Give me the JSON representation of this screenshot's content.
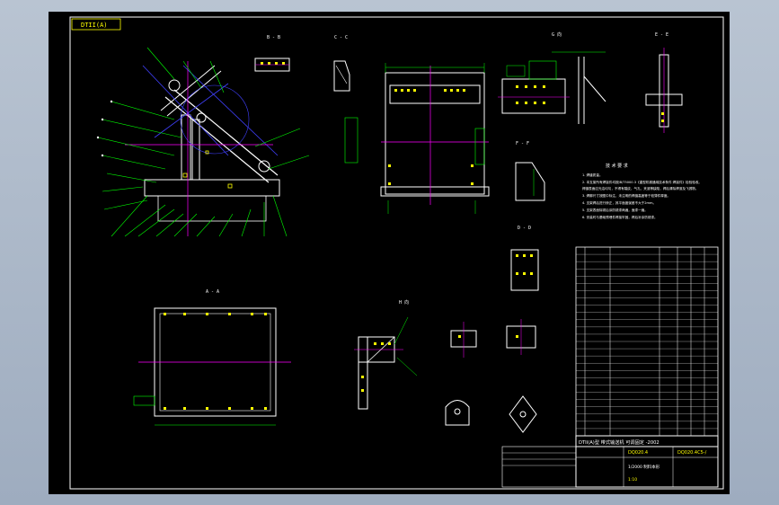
{
  "drawing": {
    "code_label": "DTII(A)",
    "title_block": {
      "main_title": "DTII(A)型 带式输送机 可调固定 -2002",
      "drawing_no": "DQ020.4",
      "sheet_code": "DQ020.4C5-/",
      "part_name": "1/2000 制料本形",
      "scale": "1:10"
    },
    "tech_requirements": {
      "heading": "技 术 要 求",
      "items": [
        "1. 焊缝质量。",
        "2. 本支架所有焊接件均按JB/T5000.3《重型机械通用技术条件 焊接件》检验验收。",
        "   焊缝表面应光洁均匀，不得有裂纹、气孔、夹渣等缺陷，焊后清除焊渣及飞溅物。",
        "3. 焊脚尺寸按图中标注，未注明的焊缝高度等于较薄件厚度。",
        "4. 支架焊后进行矫正，其平面度误差不大于2mm。",
        "5. 支架表面除锈后涂防锈漆两遍，面漆一遍。",
        "6. 安装时与基础预埋件焊接牢固，焊后补涂防锈漆。"
      ]
    },
    "view_labels": {
      "a_a": "A - A",
      "b_b": "B - B",
      "c_c": "C - C",
      "d_d": "D - D",
      "e_e": "E - E",
      "f_f": "F - F",
      "g": "G 向",
      "h": "H 向"
    },
    "scale_note": "1 : 10",
    "parts_rows": 26
  }
}
